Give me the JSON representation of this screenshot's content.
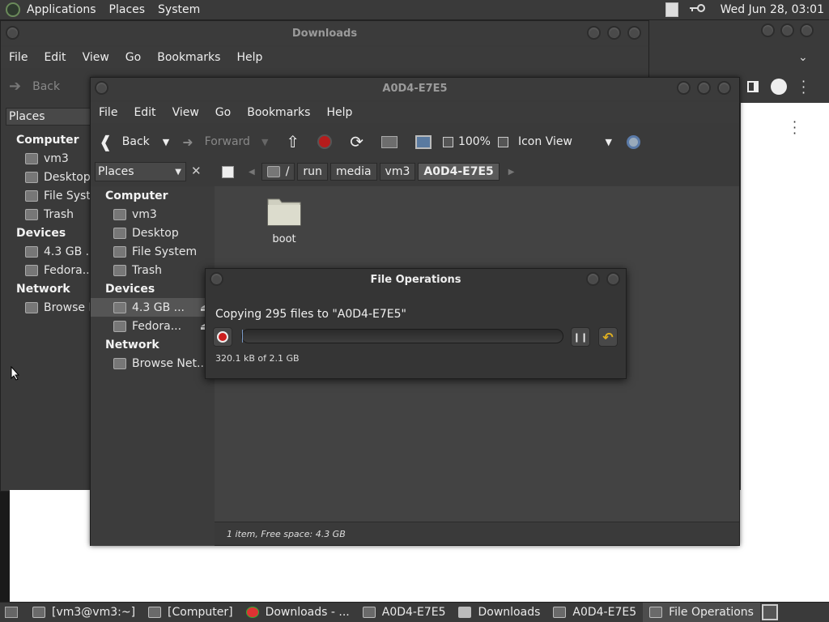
{
  "top_panel": {
    "menus": [
      "Applications",
      "Places",
      "System"
    ],
    "datetime": "Wed Jun 28, 03:01"
  },
  "downloads_window": {
    "title": "Downloads",
    "menus": [
      "File",
      "Edit",
      "View",
      "Go",
      "Bookmarks",
      "Help"
    ],
    "back_label": "Back",
    "places_label": "Places",
    "computer_heading": "Computer",
    "computer_items": [
      "vm3",
      "Desktop",
      "File System",
      "Trash"
    ],
    "devices_heading": "Devices",
    "devices_items": [
      "4.3 GB ...",
      "Fedora..."
    ],
    "network_heading": "Network",
    "network_items": [
      "Browse Ne..."
    ]
  },
  "main_window": {
    "title": "A0D4-E7E5",
    "menus": [
      "File",
      "Edit",
      "View",
      "Go",
      "Bookmarks",
      "Help"
    ],
    "toolbar": {
      "back": "Back",
      "forward": "Forward",
      "zoom": "100%",
      "view_mode": "Icon View"
    },
    "sidebar": {
      "places_label": "Places",
      "computer_heading": "Computer",
      "computer_items": [
        "vm3",
        "Desktop",
        "File System",
        "Trash"
      ],
      "devices_heading": "Devices",
      "devices_items": [
        "4.3 GB ...",
        "Fedora..."
      ],
      "network_heading": "Network",
      "network_items": [
        "Browse Net..."
      ]
    },
    "path": [
      "/",
      "run",
      "media",
      "vm3",
      "A0D4-E7E5"
    ],
    "files": [
      {
        "name": "boot",
        "icon": "folder-icon"
      }
    ],
    "status": "1 item, Free space: 4.3 GB"
  },
  "dialog": {
    "title": "File Operations",
    "message": "Copying 295 files to \"A0D4-E7E5\"",
    "progress_fraction": 0.0002,
    "detail": "320.1 kB of 2.1 GB"
  },
  "taskbar": {
    "items": [
      {
        "label": "[vm3@vm3:~]",
        "icon": "terminal-icon"
      },
      {
        "label": "[Computer]",
        "icon": "computer-icon"
      },
      {
        "label": "Downloads - ...",
        "icon": "chrome-icon"
      },
      {
        "label": "A0D4-E7E5",
        "icon": "drive-icon"
      },
      {
        "label": "Downloads",
        "icon": "folder-icon"
      },
      {
        "label": "A0D4-E7E5",
        "icon": "drive-icon"
      },
      {
        "label": "File Operations",
        "icon": "dialog-icon"
      }
    ]
  },
  "colors": {
    "panel": "#3a3a3a",
    "record_red": "#cc1f1f",
    "undo_yellow": "#e0b020"
  }
}
